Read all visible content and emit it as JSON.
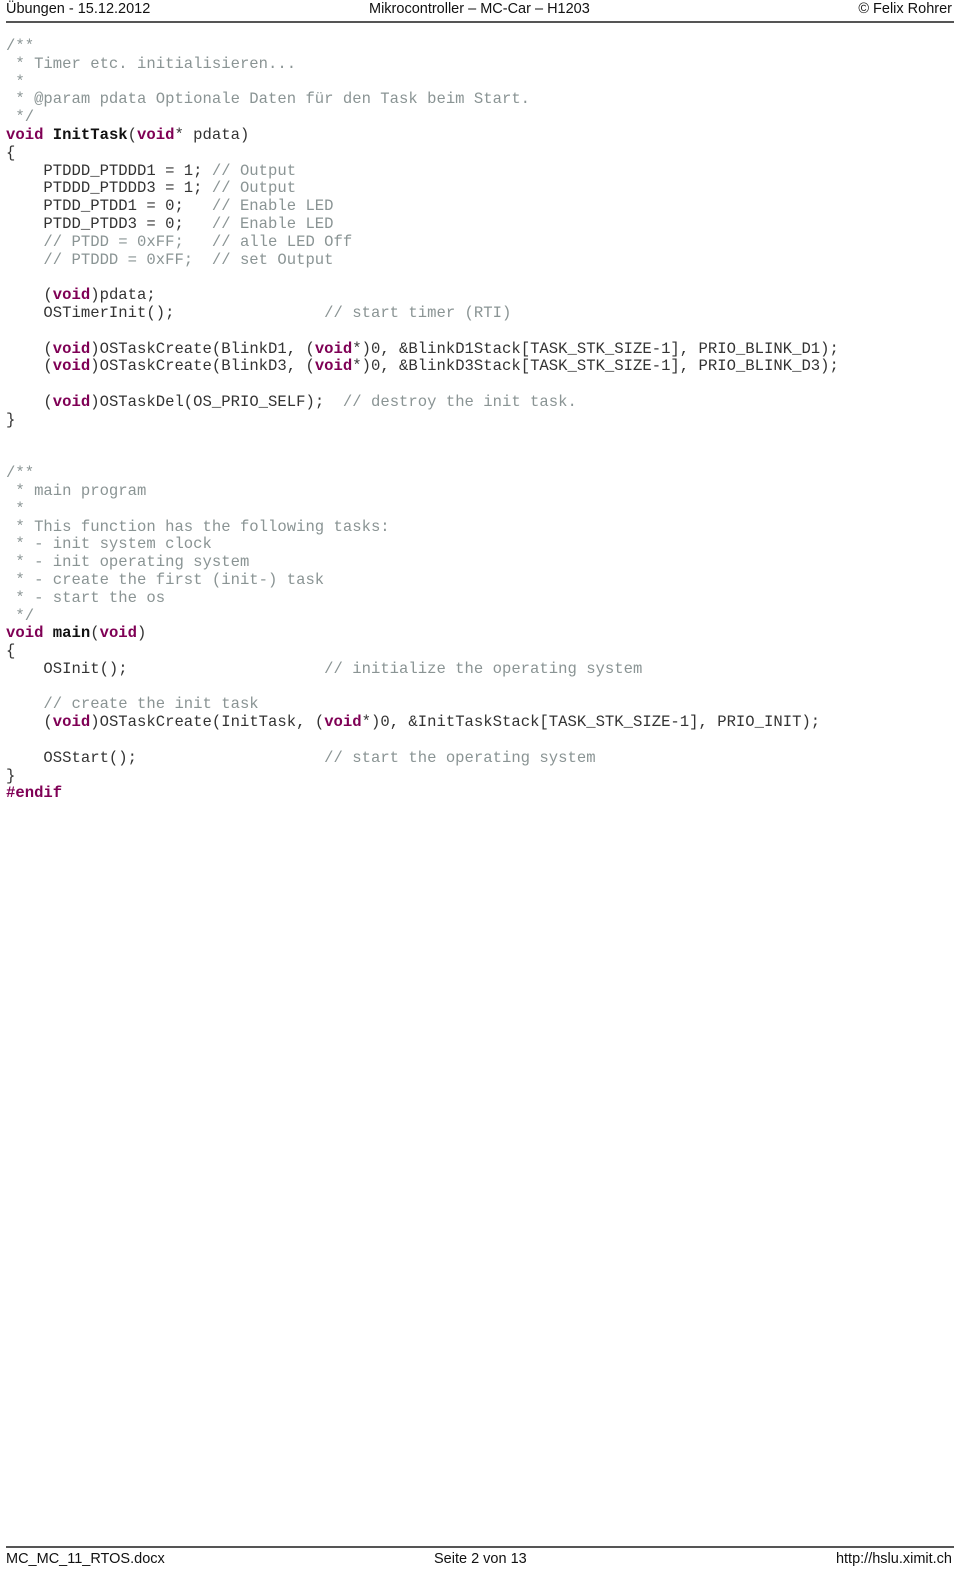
{
  "header": {
    "left": "Übungen - 15.12.2012",
    "center": "Mikrocontroller – MC-Car – H1203",
    "right": "© Felix Rohrer"
  },
  "footer": {
    "left": "MC_MC_11_RTOS.docx",
    "center": "Seite 2 von 13",
    "right": "http://hslu.ximit.ch"
  },
  "colors": {
    "keyword": "#7f0055",
    "comment": "#8a9494",
    "text": "#333333"
  },
  "code_lines": [
    [
      [
        "cm",
        "/**"
      ]
    ],
    [
      [
        "cm",
        " * Timer etc. initialisieren..."
      ]
    ],
    [
      [
        "cm",
        " *"
      ]
    ],
    [
      [
        "cm",
        " * @param pdata Optionale Daten für den Task beim Start."
      ]
    ],
    [
      [
        "cm",
        " */"
      ]
    ],
    [
      [
        "kw",
        "void"
      ],
      [
        "pl",
        " "
      ],
      [
        "fn",
        "InitTask"
      ],
      [
        "pl",
        "("
      ],
      [
        "kw",
        "void"
      ],
      [
        "pl",
        "* pdata)"
      ]
    ],
    [
      [
        "pl",
        "{"
      ]
    ],
    [
      [
        "pl",
        "    PTDDD_PTDDD1 = 1; "
      ],
      [
        "cm",
        "// Output"
      ]
    ],
    [
      [
        "pl",
        "    PTDDD_PTDDD3 = 1; "
      ],
      [
        "cm",
        "// Output"
      ]
    ],
    [
      [
        "pl",
        "    PTDD_PTDD1 = 0;   "
      ],
      [
        "cm",
        "// Enable LED"
      ]
    ],
    [
      [
        "pl",
        "    PTDD_PTDD3 = 0;   "
      ],
      [
        "cm",
        "// Enable LED"
      ]
    ],
    [
      [
        "cm",
        "    // PTDD = 0xFF;   // alle LED Off"
      ]
    ],
    [
      [
        "cm",
        "    // PTDDD = 0xFF;  // set Output"
      ]
    ],
    [
      [
        "pl",
        ""
      ]
    ],
    [
      [
        "pl",
        "    ("
      ],
      [
        "kw",
        "void"
      ],
      [
        "pl",
        ")pdata;"
      ]
    ],
    [
      [
        "pl",
        "    OSTimerInit();                "
      ],
      [
        "cm",
        "// start timer (RTI)"
      ]
    ],
    [
      [
        "pl",
        ""
      ]
    ],
    [
      [
        "pl",
        "    ("
      ],
      [
        "kw",
        "void"
      ],
      [
        "pl",
        ")OSTaskCreate(BlinkD1, ("
      ],
      [
        "kw",
        "void"
      ],
      [
        "pl",
        "*)0, &BlinkD1Stack[TASK_STK_SIZE-1], PRIO_BLINK_D1);"
      ]
    ],
    [
      [
        "pl",
        "    ("
      ],
      [
        "kw",
        "void"
      ],
      [
        "pl",
        ")OSTaskCreate(BlinkD3, ("
      ],
      [
        "kw",
        "void"
      ],
      [
        "pl",
        "*)0, &BlinkD3Stack[TASK_STK_SIZE-1], PRIO_BLINK_D3);"
      ]
    ],
    [
      [
        "pl",
        ""
      ]
    ],
    [
      [
        "pl",
        "    ("
      ],
      [
        "kw",
        "void"
      ],
      [
        "pl",
        ")OSTaskDel(OS_PRIO_SELF);  "
      ],
      [
        "cm",
        "// destroy the init task."
      ]
    ],
    [
      [
        "pl",
        "}"
      ]
    ],
    [
      [
        "pl",
        ""
      ]
    ],
    [
      [
        "pl",
        ""
      ]
    ],
    [
      [
        "cm",
        "/**"
      ]
    ],
    [
      [
        "cm",
        " * main program"
      ]
    ],
    [
      [
        "cm",
        " *"
      ]
    ],
    [
      [
        "cm",
        " * This function has the following tasks:"
      ]
    ],
    [
      [
        "cm",
        " * - init system clock"
      ]
    ],
    [
      [
        "cm",
        " * - init operating system"
      ]
    ],
    [
      [
        "cm",
        " * - create the first (init-) task"
      ]
    ],
    [
      [
        "cm",
        " * - start the os"
      ]
    ],
    [
      [
        "cm",
        " */"
      ]
    ],
    [
      [
        "kw",
        "void"
      ],
      [
        "pl",
        " "
      ],
      [
        "fn",
        "main"
      ],
      [
        "pl",
        "("
      ],
      [
        "kw",
        "void"
      ],
      [
        "pl",
        ")"
      ]
    ],
    [
      [
        "pl",
        "{"
      ]
    ],
    [
      [
        "pl",
        "    OSInit();                     "
      ],
      [
        "cm",
        "// initialize the operating system"
      ]
    ],
    [
      [
        "pl",
        ""
      ]
    ],
    [
      [
        "cm",
        "    // create the init task"
      ]
    ],
    [
      [
        "pl",
        "    ("
      ],
      [
        "kw",
        "void"
      ],
      [
        "pl",
        ")OSTaskCreate(InitTask, ("
      ],
      [
        "kw",
        "void"
      ],
      [
        "pl",
        "*)0, &InitTaskStack[TASK_STK_SIZE-1], PRIO_INIT);"
      ]
    ],
    [
      [
        "pl",
        ""
      ]
    ],
    [
      [
        "pl",
        "    OSStart();                    "
      ],
      [
        "cm",
        "// start the operating system"
      ]
    ],
    [
      [
        "pl",
        "}"
      ]
    ],
    [
      [
        "kw",
        "#endif"
      ]
    ]
  ]
}
